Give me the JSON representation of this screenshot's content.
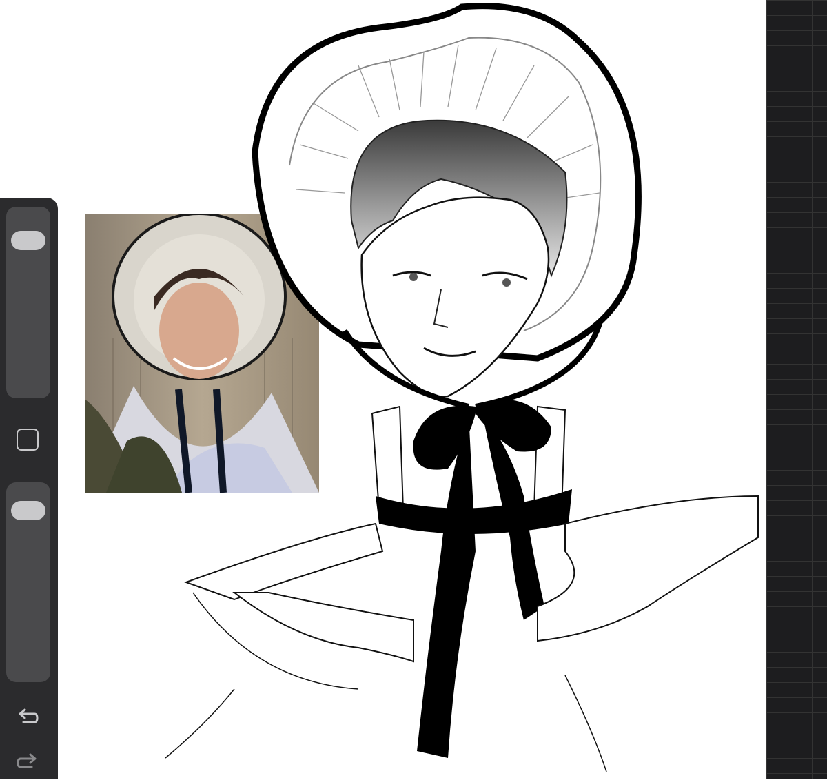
{
  "sidebar": {
    "size_slider": {
      "value": 0.88
    },
    "opacity_slider": {
      "value": 0.92
    },
    "icons": [
      "square-modify-icon",
      "undo-icon",
      "redo-icon"
    ]
  },
  "colors": {
    "sidebar_bg": "#2b2b2d",
    "slider_track": "#4a4a4c",
    "slider_knob": "#c9c9cb",
    "panel_bg": "#1d1d1f"
  }
}
